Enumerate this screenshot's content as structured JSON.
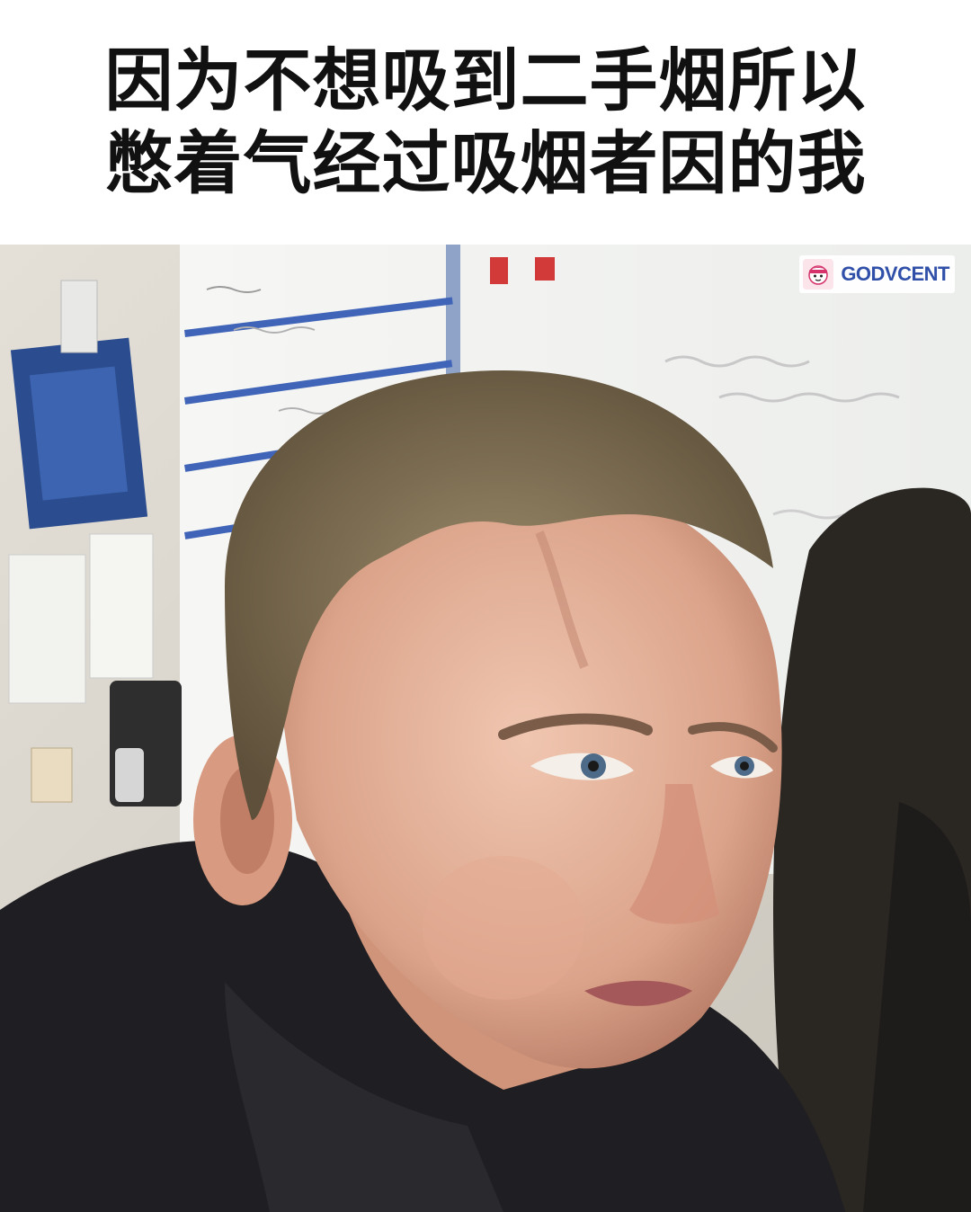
{
  "caption": {
    "line1": "因为不想吸到二手烟所以",
    "line2": "憋着气经过吸烟者因的我"
  },
  "watermark": {
    "text": "GODVCENT",
    "icon": "cartoon-face-icon",
    "color": "#2f4fa8"
  },
  "photo": {
    "icon": "meme-photo-boy-holding-breath"
  }
}
